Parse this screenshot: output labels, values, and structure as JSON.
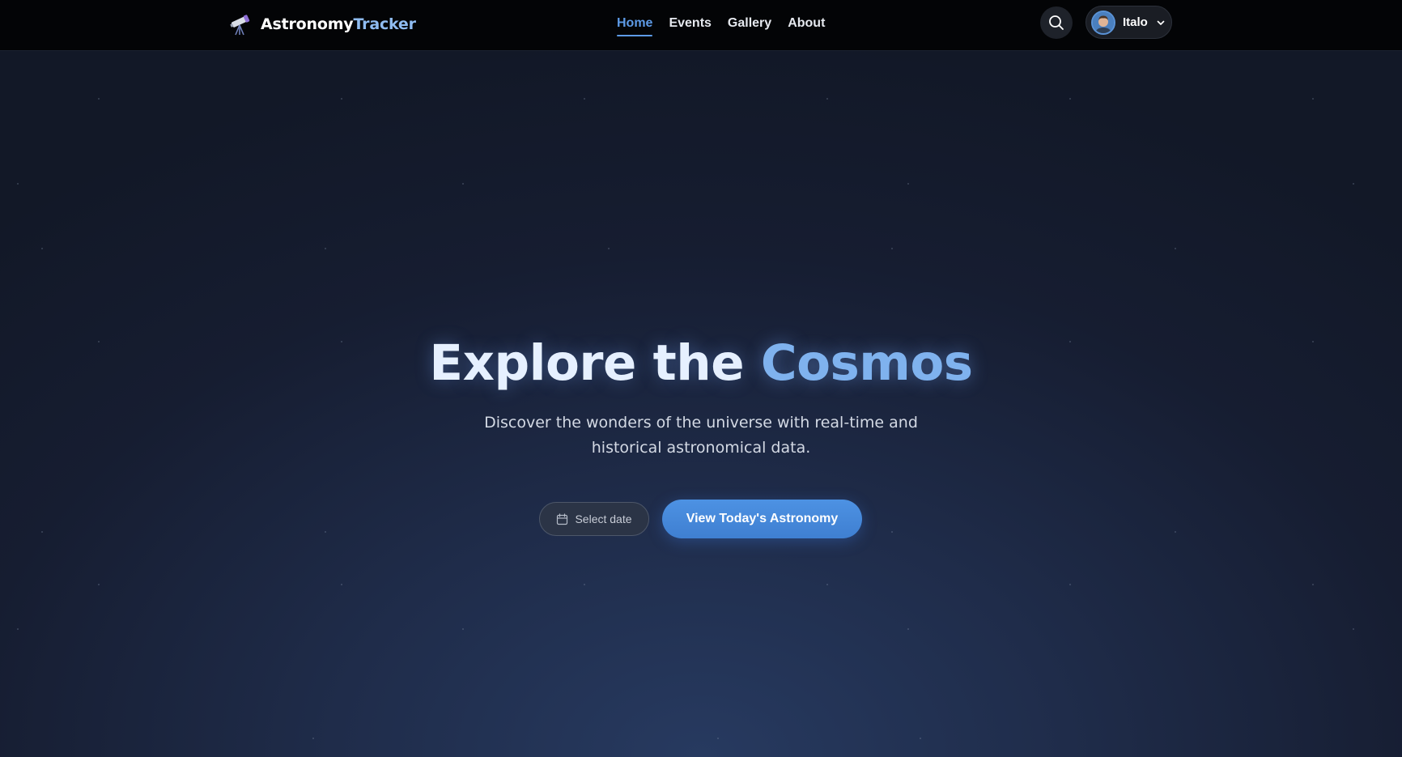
{
  "header": {
    "brand_part1": "Astronomy",
    "brand_part2": "Tracker",
    "nav": [
      {
        "label": "Home",
        "active": true
      },
      {
        "label": "Events",
        "active": false
      },
      {
        "label": "Gallery",
        "active": false
      },
      {
        "label": "About",
        "active": false
      }
    ],
    "search_icon": "search-icon",
    "user": {
      "name": "Italo",
      "dropdown_icon": "chevron-down-icon"
    }
  },
  "hero": {
    "title_part1": "Explore the ",
    "title_part2": "Cosmos",
    "subtitle": "Discover the wonders of the universe with real-time and historical astronomical data.",
    "date_button": {
      "icon": "calendar-icon",
      "label": "Select date"
    },
    "cta_label": "View Today's Astronomy"
  },
  "colors": {
    "accent": "#5d9ae6",
    "cta": "#4388da",
    "nav_bg": "#030406",
    "hero_bg_top": "#141a2b",
    "hero_bg_bottom": "#273a60"
  }
}
